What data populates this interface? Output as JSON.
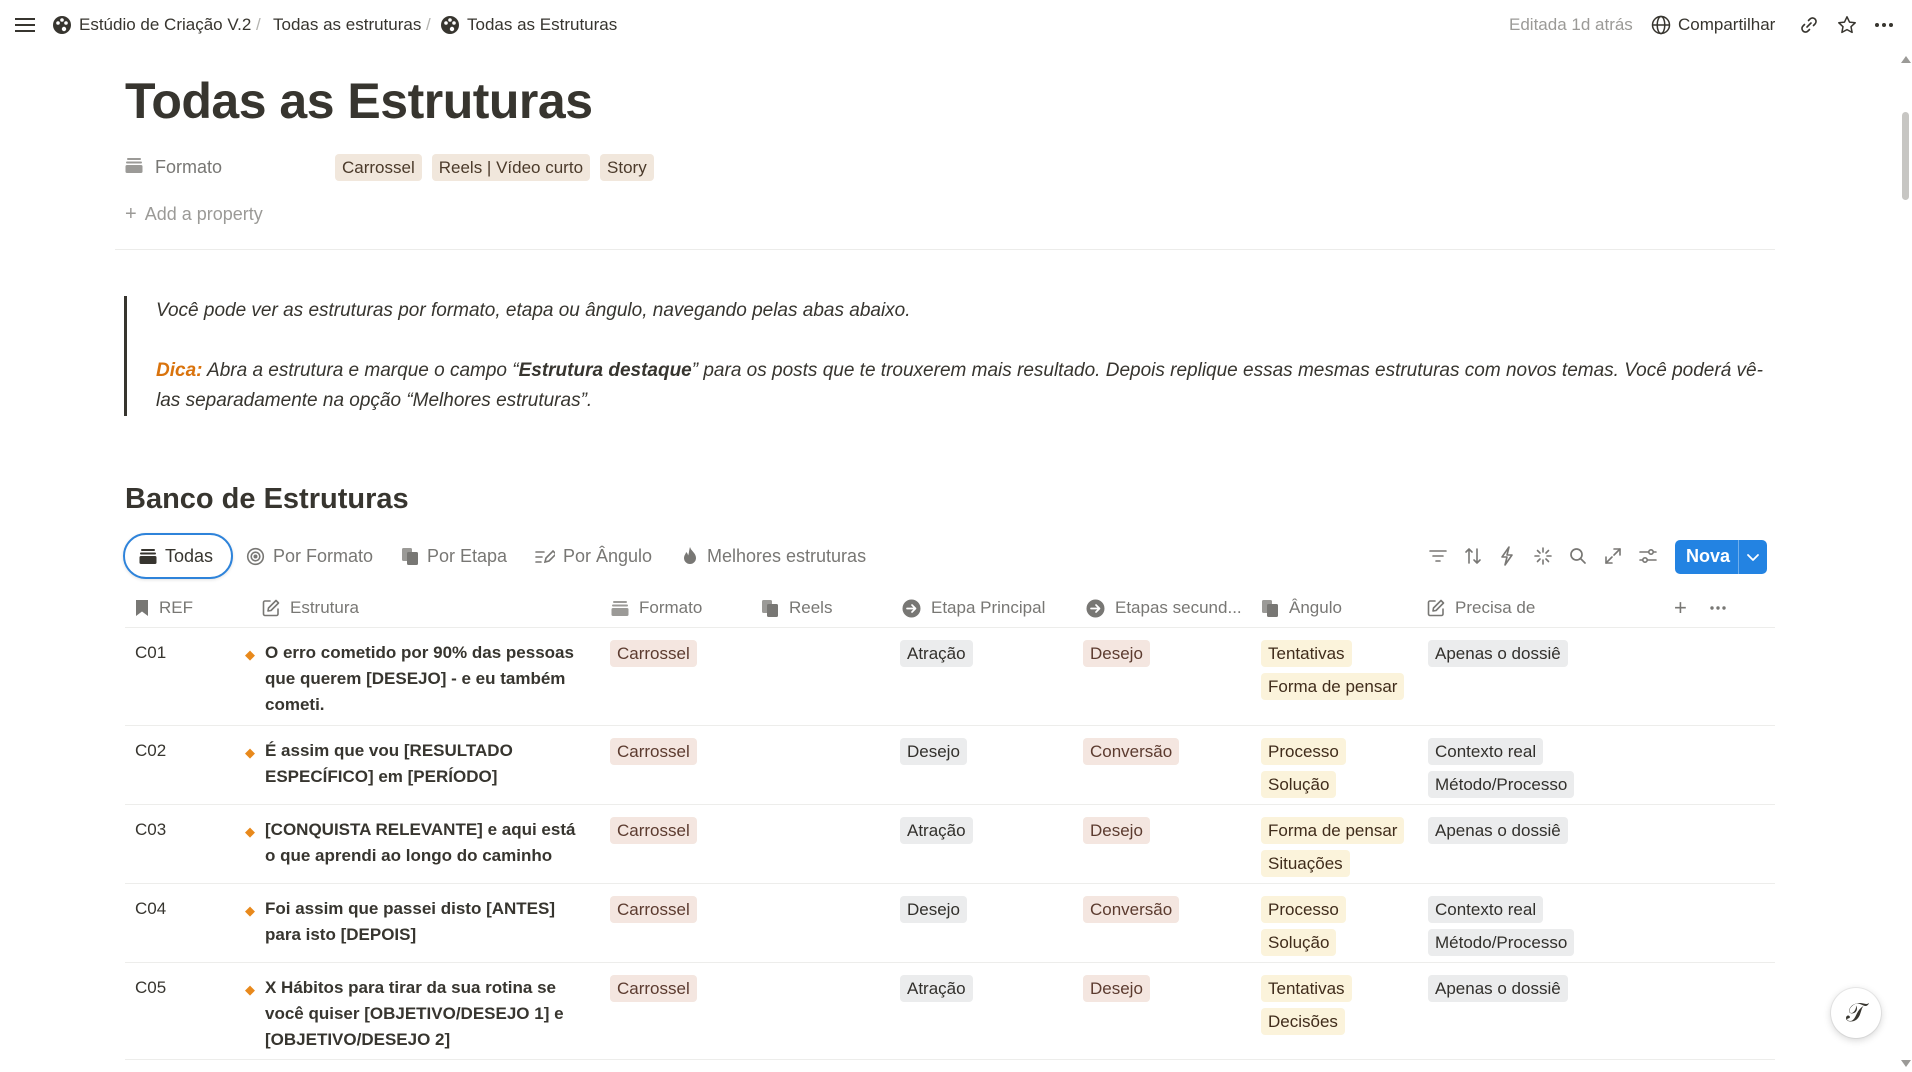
{
  "topbar": {
    "workspace": "Estúdio de Criação V.2",
    "crumb_2": "Todas as estruturas",
    "crumb_3": "Todas as Estruturas",
    "edited": "Editada 1d atrás",
    "share": "Compartilhar"
  },
  "page": {
    "title": "Todas as Estruturas",
    "property_name": "Formato",
    "property_values": [
      "Carrossel",
      "Reels | Vídeo curto",
      "Story"
    ],
    "add_property": "Add a property"
  },
  "quote": {
    "line1": "Você pode ver as estruturas por formato, etapa ou ângulo, navegando pelas abas abaixo.",
    "dica_label": "Dica:",
    "dica_text_1": " Abra a estrutura e marque o campo “",
    "dica_bold": "Estrutura destaque",
    "dica_text_2": "” para os posts que te trouxerem mais resultado. Depois replique essas mesmas estruturas com novos temas. Você poderá vê-las separadamente na opção “Melhores estruturas”."
  },
  "database": {
    "title": "Banco de Estruturas",
    "tabs": [
      "Todas",
      "Por Formato",
      "Por Etapa",
      "Por Ângulo",
      "Melhores estruturas"
    ],
    "new_button": "Nova",
    "columns": [
      "REF",
      "Estrutura",
      "Formato",
      "Reels",
      "Etapa Principal",
      "Etapas secund...",
      "Ângulo",
      "Precisa de"
    ],
    "rows": [
      {
        "ref": "C01",
        "estrutura": "O erro cometido por 90% das pessoas que querem [DESEJO] - e eu também cometi.",
        "formato": "Carrossel",
        "etapa": "Atração",
        "etapa2": "Desejo",
        "angulo": [
          "Tentativas",
          "Forma de pensar"
        ],
        "precisa": [
          "Apenas o dossiê"
        ]
      },
      {
        "ref": "C02",
        "estrutura": "É assim que vou [RESULTADO ESPECÍFICO] em [PERÍODO]",
        "formato": "Carrossel",
        "etapa": "Desejo",
        "etapa2": "Conversão",
        "angulo": [
          "Processo",
          "Solução"
        ],
        "precisa": [
          "Contexto real",
          "Método/Processo"
        ]
      },
      {
        "ref": "C03",
        "estrutura": "[CONQUISTA RELEVANTE] e aqui está o que aprendi ao longo do caminho",
        "formato": "Carrossel",
        "etapa": "Atração",
        "etapa2": "Desejo",
        "angulo": [
          "Forma de pensar",
          "Situações"
        ],
        "precisa": [
          "Apenas o dossiê"
        ]
      },
      {
        "ref": "C04",
        "estrutura": "Foi assim que passei disto [ANTES] para isto [DEPOIS]",
        "formato": "Carrossel",
        "etapa": "Desejo",
        "etapa2": "Conversão",
        "angulo": [
          "Processo",
          "Solução"
        ],
        "precisa": [
          "Contexto real",
          "Método/Processo"
        ]
      },
      {
        "ref": "C05",
        "estrutura": "X Hábitos para tirar da sua rotina se você quiser [OBJETIVO/DESEJO 1] e [OBJETIVO/DESEJO 2]",
        "formato": "Carrossel",
        "etapa": "Atração",
        "etapa2": "Desejo",
        "angulo": [
          "Tentativas",
          "Decisões"
        ],
        "precisa": [
          "Apenas o dossiê"
        ]
      }
    ]
  },
  "colors": {
    "accent": "#2383e2",
    "dica": "#d9730d",
    "diamond": "#e8891c"
  }
}
